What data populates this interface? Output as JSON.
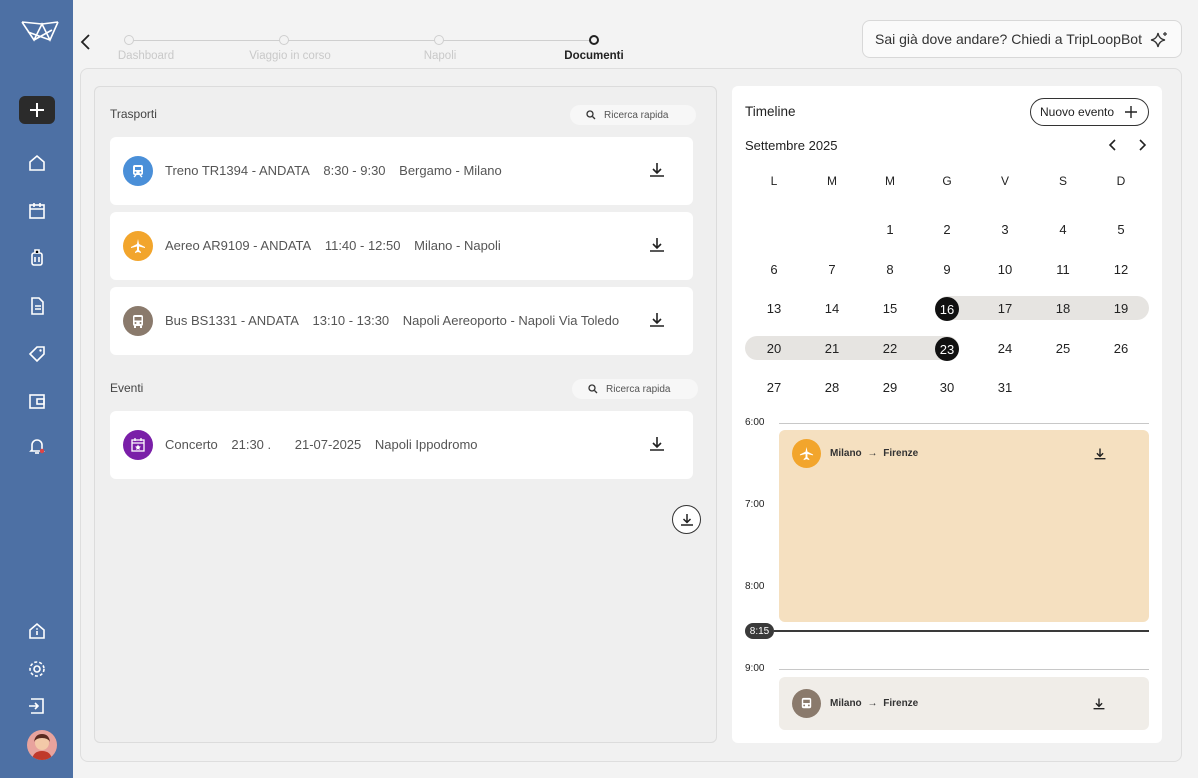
{
  "breadcrumb": {
    "steps": [
      {
        "label": "Dashboard"
      },
      {
        "label": "Viaggio in corso"
      },
      {
        "label": "Napoli"
      },
      {
        "label": "Documenti"
      }
    ]
  },
  "bot": {
    "placeholder": "Sai già dove andare? Chiedi a TripLoopBot"
  },
  "transports": {
    "title": "Trasporti",
    "search_label": "Ricerca rapida",
    "items": [
      {
        "name": "Treno TR1394 - ANDATA",
        "time": "8:30 - 9:30",
        "route": "Bergamo - Milano",
        "icon": "train-icon",
        "color": "#4a8fd8"
      },
      {
        "name": "Aereo AR9109 - ANDATA",
        "time": "11:40 - 12:50",
        "route": "Milano - Napoli",
        "icon": "plane-icon",
        "color": "#f2a52c"
      },
      {
        "name": "Bus BS1331 - ANDATA",
        "time": "13:10 - 13:30",
        "route": "Napoli Aereoporto - Napoli Via Toledo",
        "icon": "bus-icon",
        "color": "#8a7a6c"
      }
    ]
  },
  "events": {
    "title": "Eventi",
    "search_label": "Ricerca rapida",
    "items": [
      {
        "name": "Concerto",
        "time": "21:30 .",
        "date": "21-07-2025",
        "place": "Napoli  Ippodromo",
        "icon": "calendar-star-icon",
        "color": "#7a1fa8"
      }
    ]
  },
  "timeline": {
    "title": "Timeline",
    "new_event_label": "Nuovo evento",
    "month": "Settembre 2025",
    "weekdays": [
      "L",
      "M",
      "M",
      "G",
      "V",
      "S",
      "D"
    ],
    "weeks": [
      [
        "",
        "",
        "1",
        "2",
        "3",
        "4",
        "5"
      ],
      [
        "6",
        "7",
        "8",
        "9",
        "10",
        "11",
        "12"
      ],
      [
        "13",
        "14",
        "15",
        "16",
        "17",
        "18",
        "19"
      ],
      [
        "20",
        "21",
        "22",
        "23",
        "24",
        "25",
        "26"
      ],
      [
        "27",
        "28",
        "29",
        "30",
        "31",
        "",
        ""
      ]
    ],
    "selected_start": "16",
    "selected_end": "23",
    "hours": [
      "6:00",
      "7:00",
      "8:00",
      "9:00"
    ],
    "now": "8:15",
    "events": [
      {
        "from": "Milano",
        "arrow": "→",
        "to": "Firenze",
        "icon": "plane-icon",
        "color": "#f5e0c0",
        "icon_color": "#f2a52c"
      },
      {
        "from": "Milano",
        "arrow": "→",
        "to": "Firenze",
        "icon": "bus-icon",
        "color": "#f0ede8",
        "icon_color": "#8a7a6c"
      }
    ]
  }
}
